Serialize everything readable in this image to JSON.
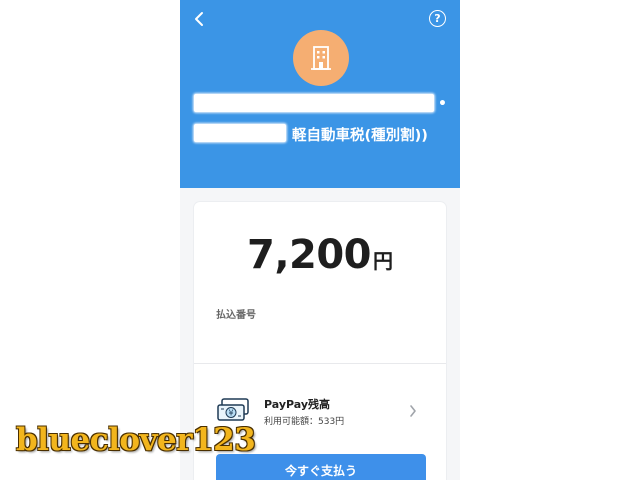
{
  "header": {
    "help_symbol": "?",
    "payee_icon": "building-icon",
    "tax_name": "軽自動車税(種別割))",
    "background_color": "#3b95e6",
    "avatar_color": "#f5ae72"
  },
  "payment": {
    "amount": "7,200",
    "currency_unit": "円",
    "payment_number_label": "払込番号"
  },
  "method": {
    "icon": "cash-icon",
    "title": "PayPay残高",
    "balance_text": "利用可能額：533円"
  },
  "actions": {
    "pay_now_label": "今すぐ支払う",
    "button_color": "#3e90ea"
  },
  "watermark": {
    "text": "blueclover123"
  }
}
